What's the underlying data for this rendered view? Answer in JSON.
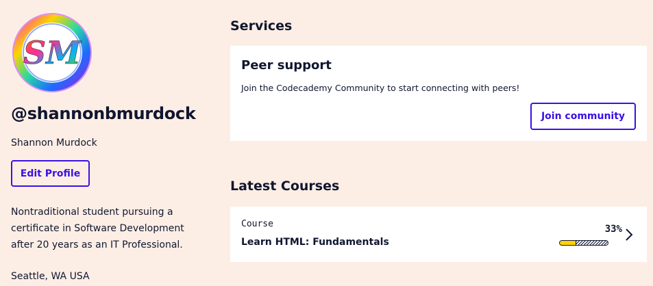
{
  "profile": {
    "avatar_icon": "sm-monogram-avatar-icon",
    "avatar_initials": "SM",
    "username": "@shannonbmurdock",
    "full_name": "Shannon Murdock",
    "edit_button_label": "Edit Profile",
    "bio": "Nontraditional student pursuing a certificate in Software Development after 20 years as an IT Professional.",
    "location": "Seattle, WA USA"
  },
  "services": {
    "title": "Services",
    "peer_support": {
      "title": "Peer support",
      "description": "Join the Codecademy Community to start connecting with peers!",
      "button_label": "Join community"
    }
  },
  "latest_courses": {
    "title": "Latest Courses",
    "items": [
      {
        "type": "Course",
        "name": "Learn HTML: Fundamentals",
        "progress_label": "33%",
        "progress_fraction": 0.33,
        "chevron_icon": "chevron-right-icon"
      }
    ]
  },
  "colors": {
    "background": "#fdeee5",
    "accent": "#3a10e5",
    "text": "#10162f",
    "progress": "#ffd300"
  }
}
